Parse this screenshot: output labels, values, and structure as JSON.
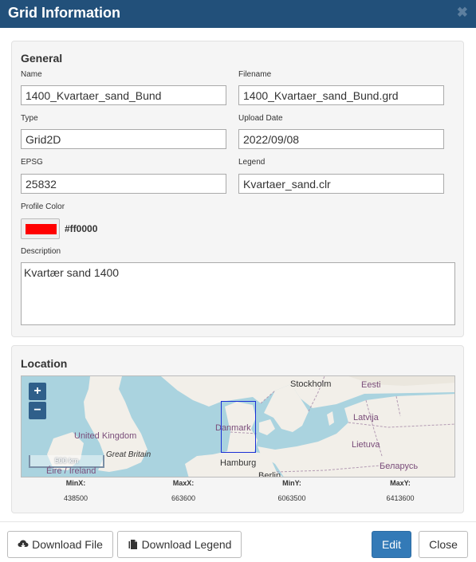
{
  "window": {
    "title": "Grid Information",
    "close_glyph": "✖"
  },
  "general": {
    "heading": "General",
    "name": {
      "label": "Name",
      "value": "1400_Kvartaer_sand_Bund"
    },
    "filename": {
      "label": "Filename",
      "value": "1400_Kvartaer_sand_Bund.grd"
    },
    "type": {
      "label": "Type",
      "value": "Grid2D"
    },
    "upload_date": {
      "label": "Upload Date",
      "value": "2022/09/08"
    },
    "epsg": {
      "label": "EPSG",
      "value": "25832"
    },
    "legend": {
      "label": "Legend",
      "value": "Kvartaer_sand.clr"
    },
    "profile_color": {
      "label": "Profile Color",
      "value": "#ff0000"
    },
    "description": {
      "label": "Description",
      "value": "Kvartær sand 1400"
    }
  },
  "location": {
    "heading": "Location",
    "map": {
      "zoom_in": "+",
      "zoom_out": "−",
      "scale": "500 km",
      "labels": {
        "stockholm": "Stockholm",
        "eesti": "Eesti",
        "latvija": "Latvija",
        "lietuva": "Lietuva",
        "danmark": "Danmark",
        "united_kingdom": "United Kingdom",
        "great_britain": "Great Britain",
        "eire": "Éire / Ireland",
        "hamburg": "Hamburg",
        "belarus": "Беларусь",
        "berlin": "Berlin"
      }
    },
    "coords": {
      "minx": {
        "label": "MinX:",
        "value": "438500"
      },
      "maxx": {
        "label": "MaxX:",
        "value": "663600"
      },
      "miny": {
        "label": "MinY:",
        "value": "6063500"
      },
      "maxy": {
        "label": "MaxY:",
        "value": "6413600"
      }
    }
  },
  "footer": {
    "download_file": "Download File",
    "download_legend": "Download Legend",
    "edit": "Edit",
    "close": "Close"
  },
  "icons": {
    "close": "close-icon",
    "download_file": "cloud-download-icon",
    "download_legend": "files-icon"
  },
  "colors": {
    "titlebar": "#22507a",
    "primary": "#337ab7",
    "profile": "#ff0000",
    "sea": "#aad3df",
    "land": "#f2efe9",
    "bbox": "#1a2fd6"
  }
}
